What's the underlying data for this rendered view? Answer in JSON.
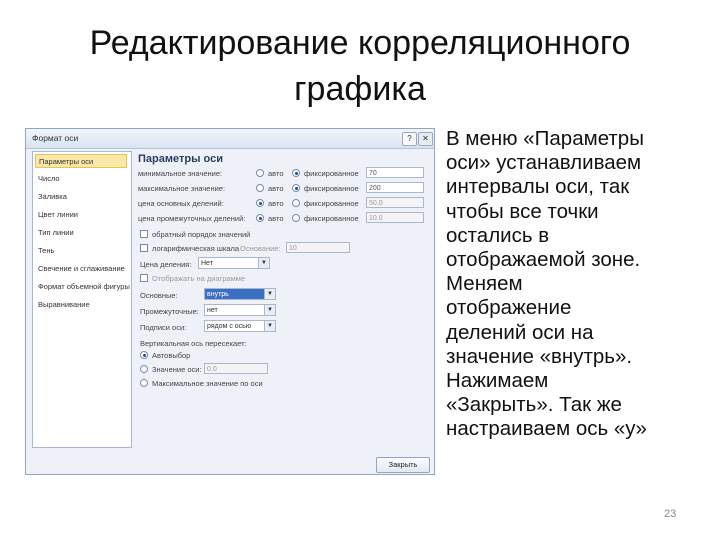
{
  "slide": {
    "title_lines": [
      "Редактирование корреляционного",
      "графика"
    ],
    "description_lines": [
      "В меню «Параметры",
      "оси» устанавливаем",
      "интервалы оси, так",
      "чтобы все точки",
      "остались в",
      "отображаемой зоне.",
      "Меняем",
      "отображение",
      "делений оси на",
      "значение «внутрь».",
      "Нажимаем",
      "«Закрыть». Так же",
      "настраиваем ось «y»"
    ],
    "page_number": "23"
  },
  "dialog": {
    "title": "Формат оси",
    "help_label": "?",
    "close_label": "✕",
    "sidebar": [
      "Параметры оси",
      "Число",
      "Заливка",
      "Цвет линии",
      "Тип линии",
      "Тень",
      "Свечение и сглаживание",
      "Формат объемной фигуры",
      "Выравнивание"
    ],
    "section_title": "Параметры оси",
    "auto_label": "авто",
    "fixed_label": "фиксированное",
    "rows": [
      {
        "label": "минимальное значение:",
        "value": "70"
      },
      {
        "label": "максимальное значение:",
        "value": "200"
      },
      {
        "label": "цена основных делений:",
        "value": "50.0"
      },
      {
        "label": "цена промежуточных делений:",
        "value": "10.0"
      }
    ],
    "reverse_label": "обратный порядок значений",
    "log_label": "логарифмическая шкала",
    "log_base_label": "Основание:",
    "log_base_value": "10",
    "display_units_label": "Цена деления:",
    "display_units_value": "Нет",
    "show_units_label": "Отображать на диаграмме",
    "major_tick_label": "Основные:",
    "major_tick_value": "внутрь",
    "minor_tick_label": "Промежуточные:",
    "minor_tick_value": "нет",
    "tick_labels_label": "Подписи оси:",
    "tick_labels_value": "рядом с осью",
    "cross_label": "Вертикальная ось пересекает:",
    "cross_options": [
      "Автовыбор",
      "Значение оси:",
      "Максимальное значение по оси"
    ],
    "cross_value": "0.0",
    "close_button": "Закрыть"
  }
}
